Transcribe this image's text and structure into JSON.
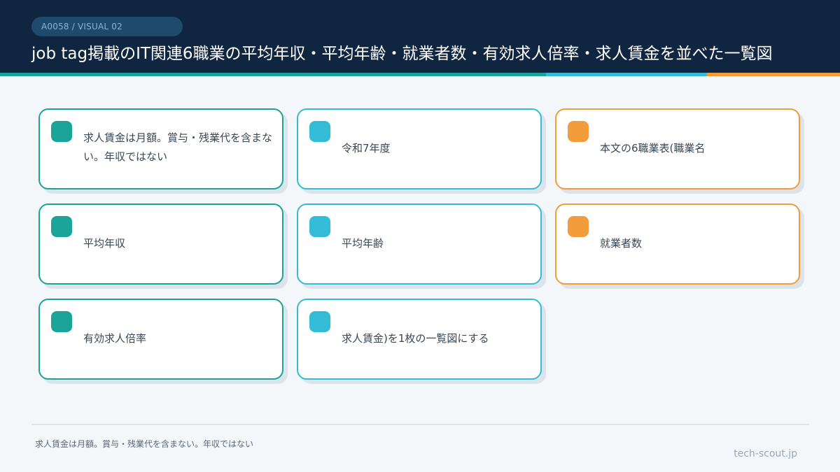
{
  "header": {
    "badge": "A0058 / VISUAL 02",
    "title": "job tag掲載のIT関連6職業の平均年収・平均年齢・就業者数・有効求人倍率・求人賃金を並べた一覧図"
  },
  "colors": {
    "teal": "#1aa399",
    "cyan": "#34bcd6",
    "orange": "#f39c3c",
    "navy": "#10253f"
  },
  "cards": [
    {
      "text": "求人賃金は月額。賞与・残業代を含まない。年収ではない"
    },
    {
      "text": "令和7年度"
    },
    {
      "text": "本文の6職業表(職業名"
    },
    {
      "text": "平均年収"
    },
    {
      "text": "平均年齢"
    },
    {
      "text": "就業者数"
    },
    {
      "text": "有効求人倍率"
    },
    {
      "text": "求人賃金)を1枚の一覧図にする"
    }
  ],
  "footer": {
    "note": "求人賃金は月額。賞与・残業代を含まない。年収ではない",
    "site": "tech-scout.jp"
  }
}
